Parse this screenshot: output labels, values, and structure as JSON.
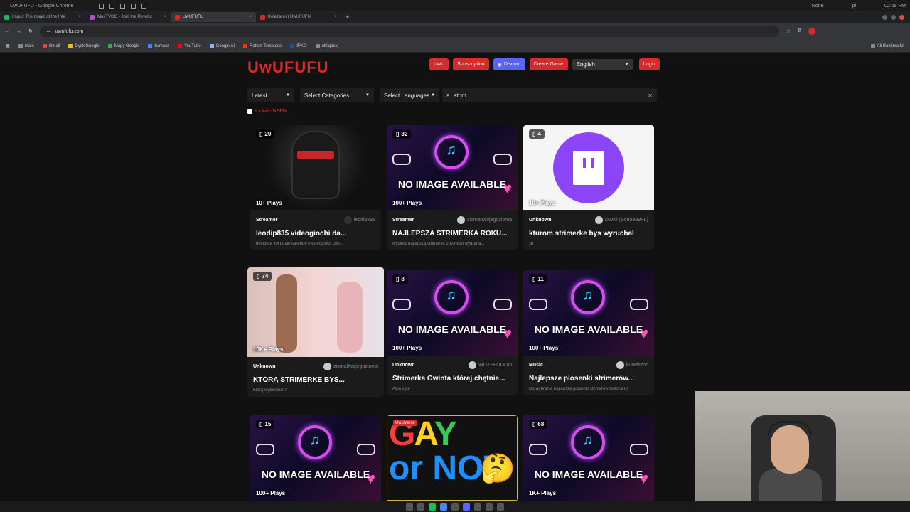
{
  "os": {
    "title": "UwUFUFU - Google Chrome",
    "right": [
      "None",
      "pl",
      "02:28 PM"
    ]
  },
  "tabs": [
    {
      "label": "Imgur: The magic of the Inte",
      "color": "#1bb76e"
    },
    {
      "label": "MaxTVGO - Join the Revolut",
      "color": "#b04ec9"
    },
    {
      "label": "UwUFUFU",
      "color": "#d62b2b"
    },
    {
      "label": "Koleżanki | UwUFUFU",
      "color": "#d62b2b"
    }
  ],
  "address": {
    "url": "uwufufu.com"
  },
  "bookmarks": [
    {
      "label": "main",
      "color": "#888"
    },
    {
      "label": "Gmail",
      "color": "#ea4335"
    },
    {
      "label": "Dysk Google",
      "color": "#fbbc04"
    },
    {
      "label": "Mapy Google",
      "color": "#34a853"
    },
    {
      "label": "tłumacz",
      "color": "#4285f4"
    },
    {
      "label": "YouTube",
      "color": "#ff0000"
    },
    {
      "label": "Google AI",
      "color": "#8ab4f8"
    },
    {
      "label": "Rotten Tomatoes",
      "color": "#fa320a"
    },
    {
      "label": "IPKO",
      "color": "#1d4f91"
    },
    {
      "label": "obligacje",
      "color": "#888"
    }
  ],
  "all_bookmarks": "All Bookmarks",
  "site": {
    "logo": "UwUFUFU",
    "nav": {
      "uwu": "UwU",
      "subscription": "Subscription",
      "discord": "Discord",
      "create": "Create Game",
      "language": "English",
      "login": "Login"
    },
    "filters": {
      "sort": "Latest",
      "categories": "Select Categories",
      "languages": "Select Languages"
    },
    "search": {
      "value": "strim"
    },
    "nsfw_label": "Include NSFW"
  },
  "no_image_text": "NO IMAGE AVAILABLE",
  "cards": [
    {
      "count": "20",
      "plays": "10+ Plays",
      "category": "Streamer",
      "author": "leodip835",
      "title": "leodip835 videogiochi da...",
      "desc": "decidete voi quale sarebbe il videogioco che..."
    },
    {
      "count": "32",
      "plays": "100+ Plays",
      "category": "Streamer",
      "author": "ziomaltwojegozioma",
      "title": "NAJLEPSZA STRIMERKA ROKU...",
      "desc": "wybierz najlepszą strimerke 2024 kuo wygrana..."
    },
    {
      "count": "4",
      "plays": "10+ Plays",
      "category": "Unknown",
      "author": "DZIKI (Squo999PL)",
      "title": "kturom strimerke bys wyruchal",
      "desc": "xd"
    },
    {
      "count": "74",
      "plays": "10K+ Plays",
      "category": "Unknown",
      "author": "ziomaltwojegozioma",
      "title": "KTÓRĄ STRIMERKE BYŚ...",
      "desc": "Którą wybierasz ?"
    },
    {
      "count": "8",
      "plays": "100+ Plays",
      "category": "Unknown",
      "author": "WOTEFOOOO",
      "title": "Strimerka Gwinta której chętnie...",
      "desc": "Albo cipe"
    },
    {
      "count": "11",
      "plays": "100+ Plays",
      "category": "Music",
      "author": "kurwiszon",
      "title": "Najlepsze piosenki strimerów...",
      "desc": "Do wybrania najlepsze piosenki strimerów twitcha B)"
    },
    {
      "count": "15",
      "plays": "100+ Plays"
    },
    {
      "badge": "UwUverse",
      "gay_word": "GAY",
      "or_not": "or NOT"
    },
    {
      "count": "68",
      "plays": "1K+ Plays"
    }
  ]
}
